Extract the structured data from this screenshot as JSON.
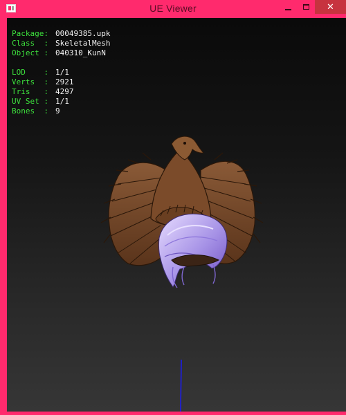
{
  "window": {
    "title": "UE Viewer",
    "close_glyph": "✕"
  },
  "stats": {
    "package": {
      "label": "Package:",
      "value": "00049385.upk"
    },
    "class": {
      "label": "Class  :",
      "value": "SkeletalMesh"
    },
    "object": {
      "label": "Object :",
      "value": "040310_KunN"
    },
    "lod": {
      "label": "LOD    :",
      "value": "1/1"
    },
    "verts": {
      "label": "Verts  :",
      "value": "2921"
    },
    "tris": {
      "label": "Tris   :",
      "value": "4297"
    },
    "uvset": {
      "label": "UV Set :",
      "value": "1/1"
    },
    "bones": {
      "label": "Bones  :",
      "value": "9"
    }
  },
  "colors": {
    "frame": "#ff2a6d",
    "label_green": "#3de13d",
    "value_white": "#f2f2f2",
    "feather_brown": "#7a4a2a",
    "hair_lilac": "#b7a3ec",
    "axis_blue": "#1a1aff"
  },
  "icons": {
    "app": "app-icon",
    "minimize": "minimize-icon",
    "maximize": "maximize-icon",
    "close": "close-icon"
  }
}
